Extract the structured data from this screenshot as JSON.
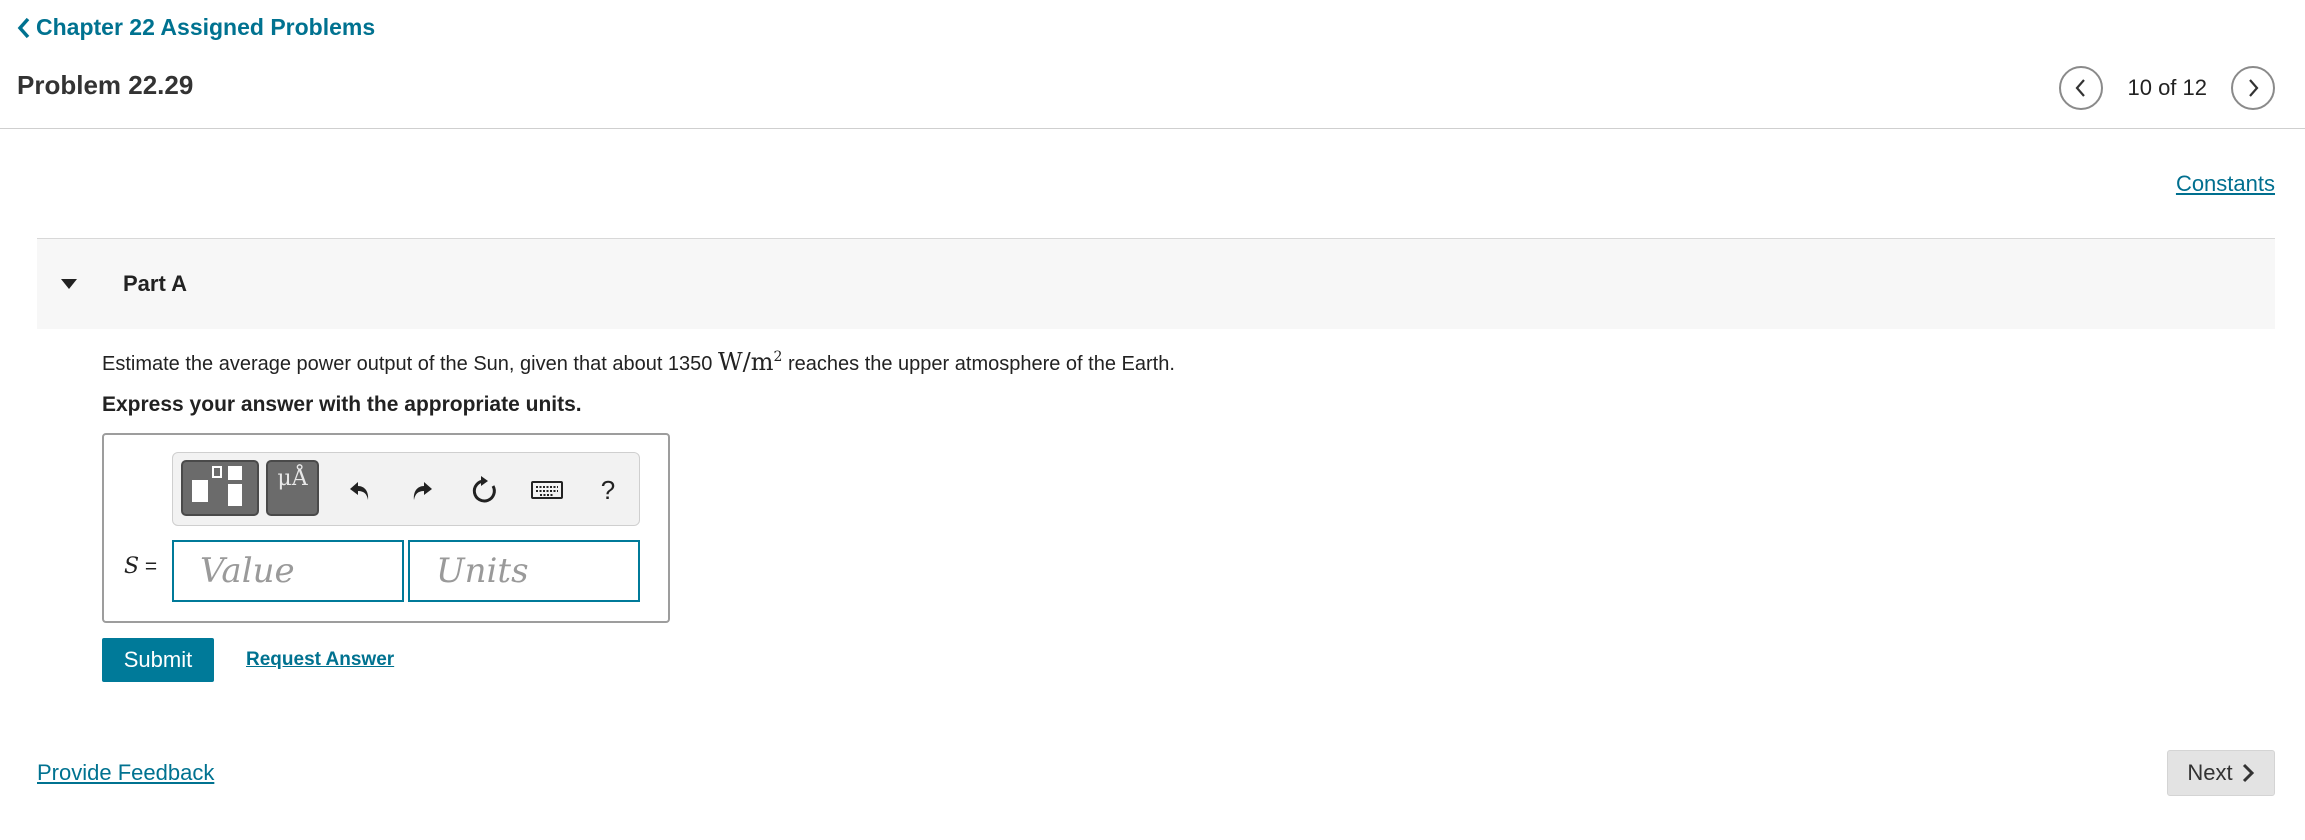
{
  "header": {
    "back_label": "Chapter 22 Assigned Problems",
    "problem_title": "Problem 22.29",
    "pager_text": "10 of 12"
  },
  "constants_label": "Constants",
  "part": {
    "label": "Part A",
    "question_pre": "Estimate the average power output of the Sun, given that about 1350",
    "question_unit_base": "W/m",
    "question_unit_exp": "2",
    "question_post": "reaches the upper atmosphere of the Earth.",
    "instruction": "Express your answer with the appropriate units."
  },
  "toolbar": {
    "units_glyph": "μÅ",
    "help_glyph": "?"
  },
  "answer": {
    "variable": "S",
    "equals": "=",
    "value_placeholder": "Value",
    "units_placeholder": "Units",
    "value": "",
    "units": ""
  },
  "actions": {
    "submit_label": "Submit",
    "request_answer_label": "Request Answer"
  },
  "footer": {
    "feedback_label": "Provide Feedback",
    "next_label": "Next"
  },
  "colors": {
    "accent": "#007290",
    "submit_bg": "#007a99",
    "part_header_bg": "#f7f7f7"
  }
}
